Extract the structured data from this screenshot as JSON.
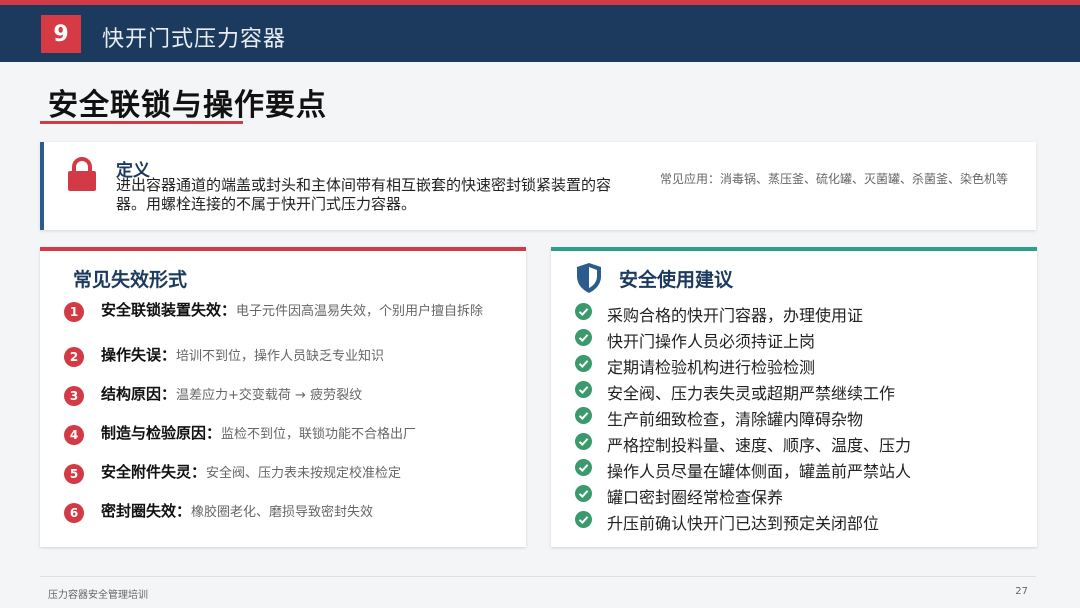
{
  "header": {
    "chapter_number": "9",
    "chapter_title": "快开门式压力容器"
  },
  "page_title": "安全联锁与操作要点",
  "definition": {
    "heading": "定义",
    "body": "进出容器通道的端盖或封头和主体间带有相互嵌套的快速密封锁紧装置的容器。用螺栓连接的不属于快开门式压力容器。",
    "applications": "常见应用：消毒锅、蒸压釜、硫化罐、灭菌罐、杀菌釜、染色机等"
  },
  "failure_panel": {
    "title": "常见失效形式",
    "items": [
      {
        "num": "1",
        "label": "安全联锁装置失效：",
        "desc": "电子元件因高温易失效，个别用户擅自拆除"
      },
      {
        "num": "2",
        "label": "操作失误：",
        "desc": "培训不到位，操作人员缺乏专业知识"
      },
      {
        "num": "3",
        "label": "结构原因：",
        "desc": "温差应力+交变载荷 → 疲劳裂纹"
      },
      {
        "num": "4",
        "label": "制造与检验原因：",
        "desc": "监检不到位，联锁功能不合格出厂"
      },
      {
        "num": "5",
        "label": "安全附件失灵：",
        "desc": "安全阀、压力表未按规定校准检定"
      },
      {
        "num": "6",
        "label": "密封圈失效：",
        "desc": "橡胶圈老化、磨损导致密封失效"
      }
    ]
  },
  "safety_panel": {
    "title": "安全使用建议",
    "items": [
      "采购合格的快开门容器，办理使用证",
      "快开门操作人员必须持证上岗",
      "定期请检验机构进行检验检测",
      "安全阀、压力表失灵或超期严禁继续工作",
      "生产前细致检查，清除罐内障碍杂物",
      "严格控制投料量、速度、顺序、温度、压力",
      "操作人员尽量在罐体侧面，罐盖前严禁站人",
      "罐口密封圈经常检查保养",
      "升压前确认快开门已达到预定关闭部位"
    ]
  },
  "footer": {
    "left": "压力容器安全管理培训",
    "page": "27"
  },
  "colors": {
    "navy": "#1b3a5e",
    "red": "#d23b45",
    "teal": "#2f9d8c",
    "check_green": "#3a9a6c"
  }
}
